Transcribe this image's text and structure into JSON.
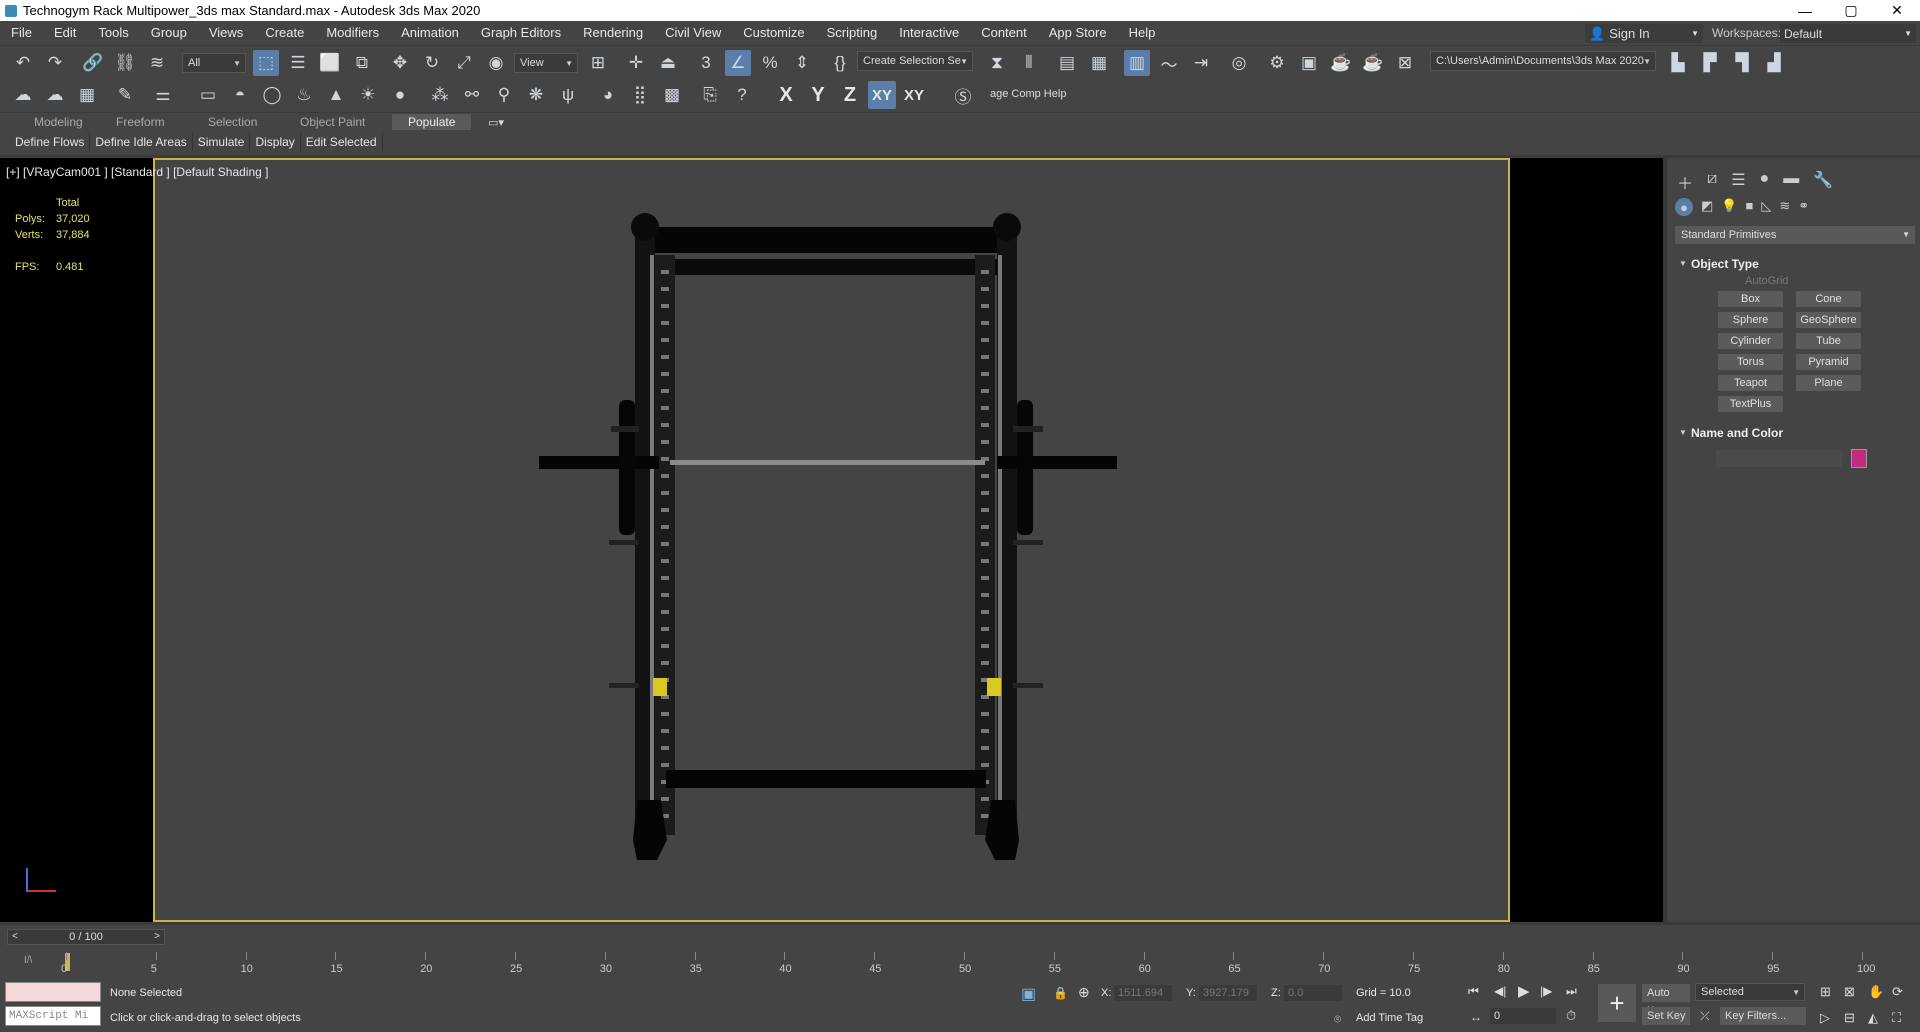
{
  "window": {
    "title": "Technogym Rack Multipower_3ds max Standard.max - Autodesk 3ds Max 2020",
    "min": "—",
    "max": "▢",
    "close": "✕"
  },
  "menu": [
    "File",
    "Edit",
    "Tools",
    "Group",
    "Views",
    "Create",
    "Modifiers",
    "Animation",
    "Graph Editors",
    "Rendering",
    "Civil View",
    "Customize",
    "Scripting",
    "Interactive",
    "Content",
    "App Store",
    "Help"
  ],
  "signin": {
    "label": "Sign In"
  },
  "workspace": {
    "label": "Workspaces:",
    "value": "Default"
  },
  "toolbar": {
    "filter": "All",
    "refcoord": "View",
    "selection_set": "Create Selection Se",
    "path": "C:\\Users\\Admin\\Documents\\3ds Max 2020",
    "axis_x": "X",
    "axis_y": "Y",
    "axis_z": "Z",
    "axis_xy": "XY",
    "axis_xy2": "XY",
    "help_text": "age Comp Help"
  },
  "ribbon": {
    "tabs": [
      "Modeling",
      "Freeform",
      "Selection",
      "Object Paint",
      "Populate"
    ],
    "active_tab": "Populate",
    "buttons": [
      "Define Flows",
      "Define Idle Areas",
      "Simulate",
      "Display",
      "Edit Selected"
    ]
  },
  "viewport": {
    "label": "[+] [VRayCam001 ] [Standard ] [Default Shading ]",
    "stats": {
      "total_label": "Total",
      "polys_label": "Polys:",
      "polys": "37,020",
      "verts_label": "Verts:",
      "verts": "37,884",
      "fps_label": "FPS:",
      "fps": "0.481"
    }
  },
  "command_panel": {
    "category": "Standard Primitives",
    "object_type_title": "Object Type",
    "autogrid": "AutoGrid",
    "buttons": [
      "Box",
      "Cone",
      "Sphere",
      "GeoSphere",
      "Cylinder",
      "Tube",
      "Torus",
      "Pyramid",
      "Teapot",
      "Plane",
      "TextPlus"
    ],
    "name_color_title": "Name and Color",
    "swatch_color": "#c32c7c"
  },
  "timeline": {
    "slider": "0 / 100",
    "ticks": [
      "0",
      "5",
      "10",
      "15",
      "20",
      "25",
      "30",
      "35",
      "40",
      "45",
      "50",
      "55",
      "60",
      "65",
      "70",
      "75",
      "80",
      "85",
      "90",
      "95",
      "100"
    ]
  },
  "status": {
    "none_selected": "None Selected",
    "prompt": "Click or click-and-drag to select objects",
    "maxscript": "MAXScript Mi",
    "x_label": "X:",
    "x_val": "1511.694",
    "y_label": "Y:",
    "y_val": "3927.179",
    "z_label": "Z:",
    "z_val": "0.0",
    "grid": "Grid = 10.0",
    "add_time_tag": "Add Time Tag",
    "autokey": "Auto Key",
    "selected": "Selected",
    "setkey": "Set Key",
    "keyfilters": "Key Filters...",
    "frame": "0"
  }
}
